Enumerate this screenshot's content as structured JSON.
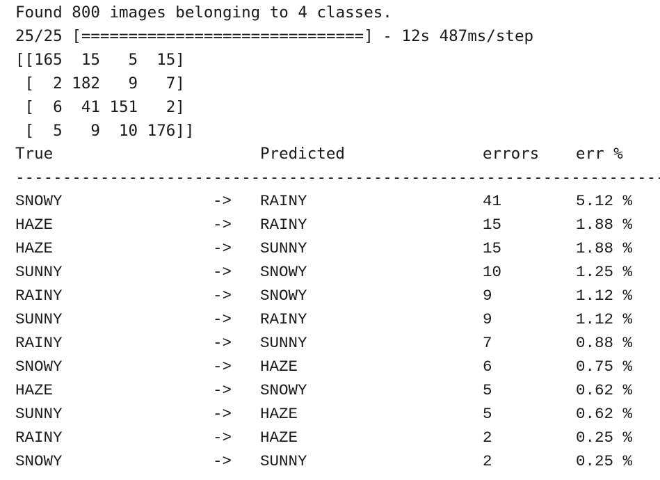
{
  "output": {
    "found_line": "Found 800 images belonging to 4 classes.",
    "progress_line": "25/25 [==============================] - 12s 487ms/step",
    "matrix_lines": [
      "[[165  15   5  15]",
      " [  2 182   9   7]",
      " [  6  41 151   2]",
      " [  5   9  10 176]]"
    ]
  },
  "table": {
    "headers": {
      "true": "True",
      "predicted": "Predicted",
      "errors": "errors",
      "err_pct": "err %"
    },
    "separator": "------------------------------------------------------------------------------",
    "arrow": "->",
    "rows": [
      {
        "true": "SNOWY",
        "arrow": "->",
        "predicted": "RAINY",
        "errors": "41",
        "pct": "5.12 %"
      },
      {
        "true": "HAZE",
        "arrow": "->",
        "predicted": "RAINY",
        "errors": "15",
        "pct": "1.88 %"
      },
      {
        "true": "HAZE",
        "arrow": "->",
        "predicted": "SUNNY",
        "errors": "15",
        "pct": "1.88 %"
      },
      {
        "true": "SUNNY",
        "arrow": "->",
        "predicted": "SNOWY",
        "errors": "10",
        "pct": "1.25 %"
      },
      {
        "true": "RAINY",
        "arrow": "->",
        "predicted": "SNOWY",
        "errors": "9",
        "pct": "1.12 %"
      },
      {
        "true": "SUNNY",
        "arrow": "->",
        "predicted": "RAINY",
        "errors": "9",
        "pct": "1.12 %"
      },
      {
        "true": "RAINY",
        "arrow": "->",
        "predicted": "SUNNY",
        "errors": "7",
        "pct": "0.88 %"
      },
      {
        "true": "SNOWY",
        "arrow": "->",
        "predicted": "HAZE",
        "errors": "6",
        "pct": "0.75 %"
      },
      {
        "true": "HAZE",
        "arrow": "->",
        "predicted": "SNOWY",
        "errors": "5",
        "pct": "0.62 %"
      },
      {
        "true": "SUNNY",
        "arrow": "->",
        "predicted": "HAZE",
        "errors": "5",
        "pct": "0.62 %"
      },
      {
        "true": "RAINY",
        "arrow": "->",
        "predicted": "HAZE",
        "errors": "2",
        "pct": "0.25 %"
      },
      {
        "true": "SNOWY",
        "arrow": "->",
        "predicted": "SUNNY",
        "errors": "2",
        "pct": "0.25 %"
      }
    ]
  }
}
